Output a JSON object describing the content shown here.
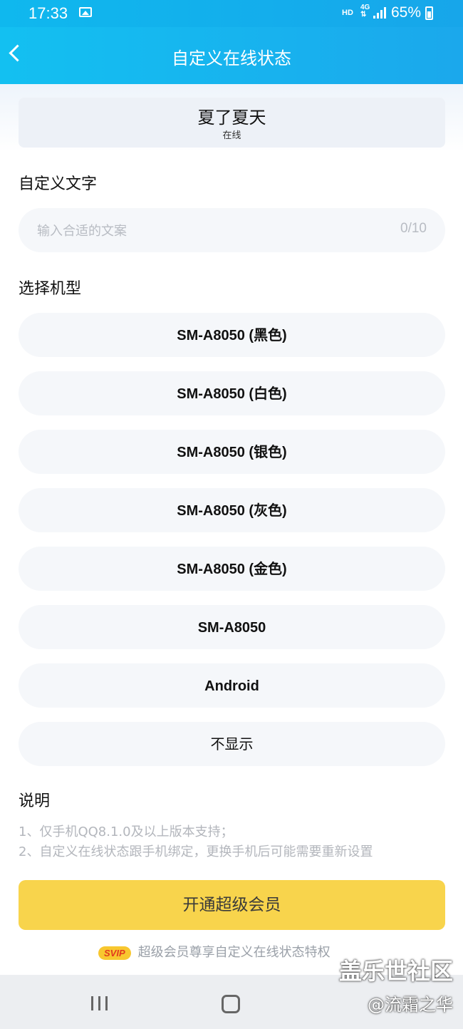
{
  "status_bar": {
    "time": "17:33",
    "hd": "HD",
    "network": "4G",
    "battery": "65%"
  },
  "header": {
    "title": "自定义在线状态"
  },
  "profile": {
    "name": "夏了夏天",
    "status": "在线"
  },
  "custom_text": {
    "section_title": "自定义文字",
    "placeholder": "输入合适的文案",
    "counter": "0/10"
  },
  "model_section": {
    "title": "选择机型",
    "options": [
      {
        "label": "SM-A8050 (黑色)"
      },
      {
        "label": "SM-A8050 (白色)"
      },
      {
        "label": "SM-A8050 (银色)"
      },
      {
        "label": "SM-A8050 (灰色)"
      },
      {
        "label": "SM-A8050 (金色)"
      },
      {
        "label": "SM-A8050"
      },
      {
        "label": "Android"
      },
      {
        "label": "不显示"
      }
    ]
  },
  "description": {
    "title": "说明",
    "lines": [
      "1、仅手机QQ8.1.0及以上版本支持；",
      "2、自定义在线状态跟手机绑定，更换手机后可能需要重新设置"
    ]
  },
  "cta": {
    "button_label": "开通超级会员",
    "badge": "SVIP",
    "note": "超级会员尊享自定义在线状态特权"
  },
  "watermark": {
    "line1": "盖乐世社区",
    "line2": "@流霜之华"
  },
  "colors": {
    "header_blue": "#15b4ef",
    "cta_yellow": "#f8d44c",
    "field_bg": "#f5f7fa"
  }
}
